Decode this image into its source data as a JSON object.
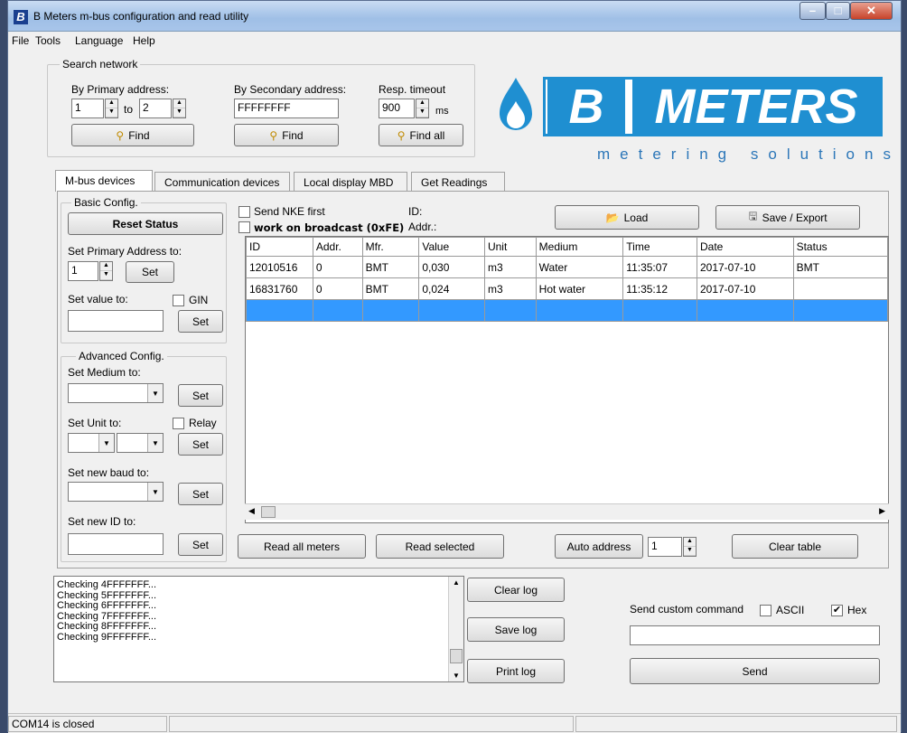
{
  "window": {
    "title": "B Meters m-bus configuration and read utility",
    "app_icon_letter": "B",
    "min": "–",
    "max": "□",
    "close": "✕"
  },
  "menu": [
    {
      "label": "File"
    },
    {
      "label": "Tools"
    },
    {
      "label": "Language"
    },
    {
      "label": "Help"
    }
  ],
  "search": {
    "legend": "Search network",
    "primary_label": "By Primary address:",
    "primary_from": "1",
    "to_label": "to",
    "primary_to": "2",
    "secondary_label": "By Secondary address:",
    "secondary_value": "FFFFFFFF",
    "timeout_label": "Resp. timeout",
    "timeout_value": "900",
    "ms_label": "ms",
    "find_label": "Find",
    "find_all_label": "Find all"
  },
  "logo": {
    "letters": [
      "B",
      "METERS"
    ],
    "tagline": "metering solutions",
    "color": "#1f8fd1"
  },
  "tabs": [
    {
      "label": "M-bus devices",
      "active": true
    },
    {
      "label": "Communication devices"
    },
    {
      "label": "Local display MBD"
    },
    {
      "label": "Get Readings"
    }
  ],
  "basic": {
    "legend": "Basic Config.",
    "reset_label": "Reset Status",
    "set_primary_label": "Set Primary Address to:",
    "primary_value": "1",
    "set_label": "Set",
    "set_value_label": "Set value to:",
    "gin_label": "GIN"
  },
  "advanced": {
    "legend": "Advanced Config.",
    "medium_label": "Set Medium to:",
    "unit_label": "Set Unit to:",
    "relay_label": "Relay",
    "baud_label": "Set new baud to:",
    "new_id_label": "Set new ID to:",
    "set_label": "Set"
  },
  "top_controls": {
    "send_nke_label": "Send NKE first",
    "broadcast_label": "work on broadcast (0xFE)",
    "id_label": "ID:",
    "addr_label": "Addr.:",
    "load_label": "Load",
    "save_export_label": "Save / Export"
  },
  "table": {
    "columns": [
      "ID",
      "Addr.",
      "Mfr.",
      "Value",
      "Unit",
      "Medium",
      "Time",
      "Date",
      "Status"
    ],
    "rows": [
      [
        "12010516",
        "0",
        "BMT",
        "0,030",
        "m3",
        "Water",
        "11:35:07",
        "2017-07-10",
        "BMT"
      ],
      [
        "16831760",
        "0",
        "BMT",
        "0,024",
        "m3",
        "Hot water",
        "11:35:12",
        "2017-07-10",
        ""
      ]
    ],
    "selected_row_color": "#3399ff"
  },
  "bottom_controls": {
    "read_all_label": "Read all meters",
    "read_selected_label": "Read selected",
    "auto_address_label": "Auto address",
    "auto_address_value": "1",
    "clear_table_label": "Clear table"
  },
  "log": {
    "lines": [
      "Checking 4FFFFFFF...",
      "Checking 5FFFFFFF...",
      "Checking 6FFFFFFF...",
      "Checking 7FFFFFFF...",
      "Checking 8FFFFFFF...",
      "Checking 9FFFFFFF..."
    ],
    "clear_label": "Clear log",
    "save_label": "Save log",
    "print_label": "Print log"
  },
  "custom": {
    "label": "Send custom command",
    "ascii_label": "ASCII",
    "ascii_checked": false,
    "hex_label": "Hex",
    "hex_checked": true,
    "hex_mark": "✔",
    "send_label": "Send"
  },
  "status": {
    "port": "COM14 is closed"
  }
}
